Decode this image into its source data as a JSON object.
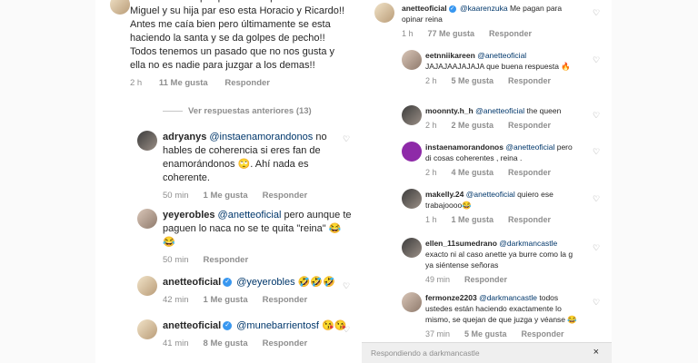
{
  "left": {
    "top_comment": {
      "text": "Anette no tiene porque dar su opinión de Luis Miguel y su hija par eso esta Horacio y Ricardo!! Antes me caía bien pero últimamente se esta haciendo la santa y se da golpes de pecho!! Todos tenemos un pasado que no nos gusta y ella no es nadie para juzgar a los demas!!",
      "time": "2 h",
      "likes": "11 Me gusta",
      "reply": "Responder"
    },
    "view_previous": "Ver respuestas anteriores (13)",
    "comments": [
      {
        "user": "adryanys",
        "mention": "@instaenamorandonos",
        "text": "no hables de coherencia si eres fan de enamorándonos 🙄. Ahí nada es coherente.",
        "time": "50 min",
        "likes": "1 Me gusta",
        "reply": "Responder"
      },
      {
        "user": "yeyerobles",
        "mention": "@anetteoficial",
        "text": "pero aunque te paguen lo naca no se te quita \"reina\" 😂😂",
        "time": "50 min",
        "reply": "Responder"
      },
      {
        "user": "anetteoficial",
        "mention": "@yeyerobles",
        "text": "🤣🤣🤣",
        "time": "42 min",
        "likes": "1 Me gusta",
        "reply": "Responder"
      },
      {
        "user": "anetteoficial",
        "mention": "@munebarrientosf",
        "text": "😘😘",
        "time": "41 min",
        "likes": "8 Me gusta",
        "reply": "Responder"
      }
    ]
  },
  "right": {
    "comments": [
      {
        "user": "anetteoficial",
        "mention": "@kaarenzuka",
        "text": "Me pagan para opinar reina",
        "time": "1 h",
        "likes": "77 Me gusta",
        "reply": "Responder"
      },
      {
        "user": "eetnniikareen",
        "mention": "@anetteoficial",
        "text": "JAJAJAAJAJAJA que buena respuesta 🔥",
        "time": "2 h",
        "likes": "5 Me gusta",
        "reply": "Responder"
      },
      {
        "user": "moonnty.h_h",
        "mention": "@anetteoficial",
        "text": "the queen",
        "time": "2 h",
        "likes": "2 Me gusta",
        "reply": "Responder"
      },
      {
        "user": "instaenamorandonos",
        "mention": "@anetteoficial",
        "text": "pero di cosas coherentes , reina .",
        "time": "2 h",
        "likes": "4 Me gusta",
        "reply": "Responder"
      },
      {
        "user": "makelly.24",
        "mention": "@anetteoficial",
        "text": "quiero ese trabajoooo😂",
        "time": "1 h",
        "likes": "1 Me gusta",
        "reply": "Responder"
      },
      {
        "user": "ellen_11sumedrano",
        "mention": "@darkmancastle",
        "text": "exacto ni al caso anette ya burre como la g ya siéntense señoras",
        "time": "49 min",
        "reply": "Responder"
      },
      {
        "user": "fermonze2203",
        "mention": "@darkmancastle",
        "text": "todos ustedes están haciendo exactamente lo mismo, se quejan de que juzga y véanse 😂",
        "time": "37 min",
        "likes": "5 Me gusta",
        "reply": "Responder"
      }
    ],
    "replying_to": "Respondiendo a darkmancastle",
    "close_label": "×"
  }
}
